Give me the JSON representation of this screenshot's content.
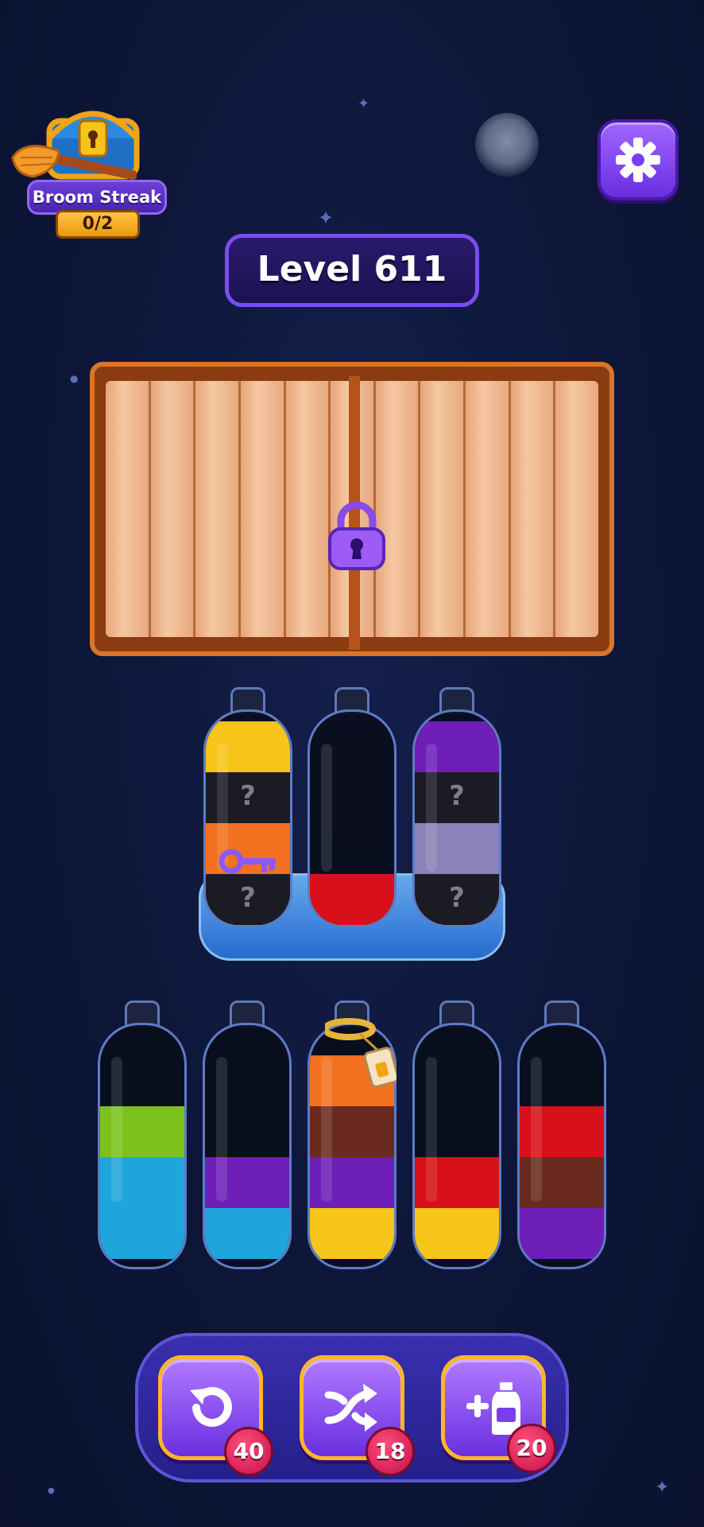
{
  "streak": {
    "label": "Broom Streak",
    "count": "0/2"
  },
  "level": {
    "label": "Level 611"
  },
  "crate": {
    "locked": true
  },
  "settings": {
    "icon": "gear-icon"
  },
  "locked_bottles": [
    {
      "layers_bottom_to_top": [
        "hidden",
        "orange",
        "hidden",
        "yellow"
      ],
      "has_key": true
    },
    {
      "layers_bottom_to_top": [
        "red"
      ]
    },
    {
      "layers_bottom_to_top": [
        "hidden",
        "lavender",
        "hidden",
        "purple"
      ]
    }
  ],
  "bottles": [
    {
      "layers_bottom_to_top": [
        "blue",
        "blue",
        "green"
      ]
    },
    {
      "layers_bottom_to_top": [
        "blue",
        "purple"
      ]
    },
    {
      "layers_bottom_to_top": [
        "yellow",
        "purple",
        "brown",
        "orange"
      ],
      "tied": true
    },
    {
      "layers_bottom_to_top": [
        "yellow",
        "red"
      ]
    },
    {
      "layers_bottom_to_top": [
        "purple",
        "brown",
        "red"
      ]
    }
  ],
  "colors": {
    "yellow": "#f7c419",
    "orange": "#f2701f",
    "red": "#d8101a",
    "purple": "#6d1fb8",
    "lavender": "#8a82b8",
    "green": "#7cc21a",
    "blue": "#1ea6dc",
    "brown": "#6a2a1e",
    "hidden": "#1b1b24"
  },
  "tools": [
    {
      "name": "undo",
      "icon": "undo-icon",
      "count": "40"
    },
    {
      "name": "shuffle",
      "icon": "shuffle-icon",
      "count": "18"
    },
    {
      "name": "add-bottle",
      "icon": "add-bottle-icon",
      "count": "20"
    }
  ]
}
